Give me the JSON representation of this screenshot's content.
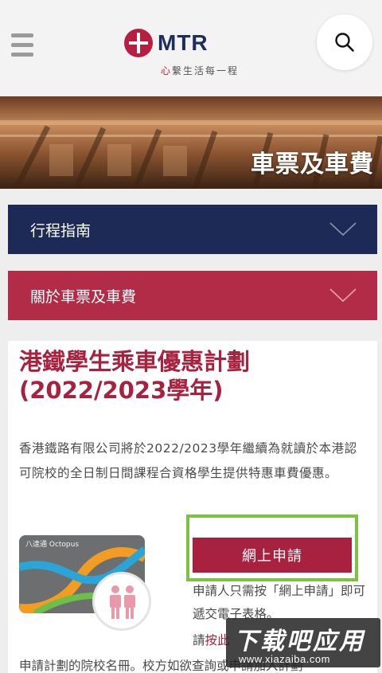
{
  "header": {
    "logo_text": "MTR",
    "tagline_prefix": "心",
    "tagline_rest": "繫生活每一程"
  },
  "banner": {
    "title": "車票及車費"
  },
  "accordions": [
    {
      "label": "行程指南"
    },
    {
      "label": "關於車票及車費"
    }
  ],
  "card": {
    "title": "港鐵學生乘車優惠計劃 (2022/2023學年)",
    "description": "香港鐵路有限公司將於2022/2023學年繼續為就讀於本港認可院校的全日制日間課程合資格學生提供特惠車費優惠。",
    "octopus_label": "八達通 Octopus",
    "apply_button": "網上申請",
    "apply_note": "申請人只需按「網上申請」即可遞交電子表格。",
    "apply_link_prefix": "請",
    "apply_link_text": "按此",
    "tail_text": "申請計劃的院校名冊。校方如欲查詢或申請加入計劃"
  },
  "watermark": {
    "main": "下载吧应用",
    "sub": "www.xiazaiba.com"
  },
  "colors": {
    "navy": "#1c2a55",
    "brand_red": "#a8223f",
    "highlight_green": "#7dc242"
  },
  "icons": [
    "menu-icon",
    "mtr-logo-icon",
    "search-icon",
    "chevron-down-icon",
    "student-icon"
  ]
}
